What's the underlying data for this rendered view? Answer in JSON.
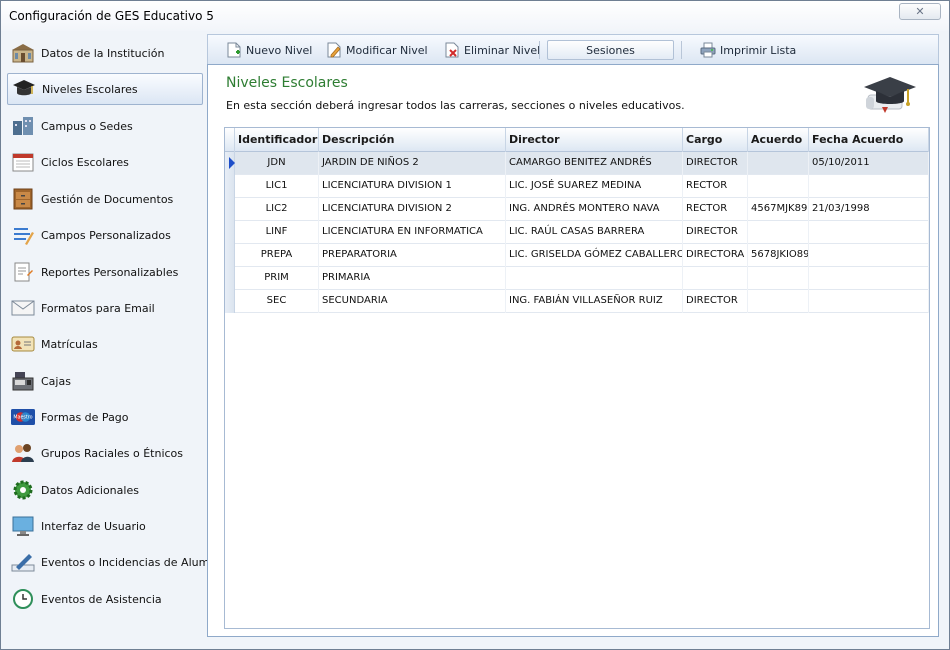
{
  "window": {
    "title": "Configuración de GES Educativo 5",
    "close_label": "✕"
  },
  "sidebar": {
    "items": [
      {
        "label": "Datos de la Institución",
        "icon": "building-icon"
      },
      {
        "label": "Niveles Escolares",
        "icon": "graduation-cap-icon",
        "active": true
      },
      {
        "label": "Campus o Sedes",
        "icon": "campus-icon"
      },
      {
        "label": "Ciclos Escolares",
        "icon": "calendar-icon"
      },
      {
        "label": "Gestión de Documentos",
        "icon": "cabinet-icon"
      },
      {
        "label": "Campos Personalizados",
        "icon": "form-fields-icon"
      },
      {
        "label": "Reportes Personalizables",
        "icon": "report-icon"
      },
      {
        "label": "Formatos para Email",
        "icon": "envelope-icon"
      },
      {
        "label": "Matrículas",
        "icon": "id-card-icon"
      },
      {
        "label": "Cajas",
        "icon": "cash-register-icon"
      },
      {
        "label": "Formas de Pago",
        "icon": "credit-card-icon"
      },
      {
        "label": "Grupos Raciales o Étnicos",
        "icon": "people-icon"
      },
      {
        "label": "Datos Adicionales",
        "icon": "gear-icon"
      },
      {
        "label": "Interfaz de Usuario",
        "icon": "monitor-icon"
      },
      {
        "label": "Eventos o Incidencias de Alumnos",
        "icon": "pen-icon"
      },
      {
        "label": "Eventos de Asistencia",
        "icon": "clock-icon"
      }
    ]
  },
  "toolbar": {
    "nuevo": "Nuevo Nivel",
    "modificar": "Modificar Nivel",
    "eliminar": "Eliminar Nivel",
    "sesiones": "Sesiones",
    "imprimir": "Imprimir Lista"
  },
  "panel": {
    "title": "Niveles Escolares",
    "description": "En esta sección deberá ingresar todos las carreras, secciones o niveles educativos."
  },
  "table": {
    "columns": [
      "Identificador",
      "Descripción",
      "Director",
      "Cargo",
      "Acuerdo",
      "Fecha Acuerdo"
    ],
    "rows": [
      [
        "JDN",
        "JARDIN DE NIÑOS 2",
        "CAMARGO BENITEZ ANDRÉS",
        "DIRECTOR",
        "",
        "05/10/2011"
      ],
      [
        "LIC1",
        "LICENCIATURA DIVISION 1",
        "LIC. JOSÉ SUAREZ MEDINA",
        "RECTOR",
        "",
        ""
      ],
      [
        "LIC2",
        "LICENCIATURA DIVISION 2",
        "ING. ANDRÉS MONTERO NAVA",
        "RECTOR",
        "4567MJK89",
        "21/03/1998"
      ],
      [
        "LINF",
        "LICENCIATURA EN INFORMATICA",
        "LIC. RAÚL CASAS BARRERA",
        "DIRECTOR",
        "",
        ""
      ],
      [
        "PREPA",
        "PREPARATORIA",
        "LIC. GRISELDA GÓMEZ CABALLERO",
        "DIRECTORA",
        "5678JKIO89",
        ""
      ],
      [
        "PRIM",
        "PRIMARIA",
        "",
        "",
        "",
        ""
      ],
      [
        "SEC",
        "SECUNDARIA",
        "ING. FABIÁN VILLASEÑOR RUIZ",
        "DIRECTOR",
        "",
        ""
      ]
    ],
    "selected_row": 0
  },
  "colors": {
    "accent_green": "#2e7d32",
    "selection_indicator": "#1d4ec9"
  }
}
